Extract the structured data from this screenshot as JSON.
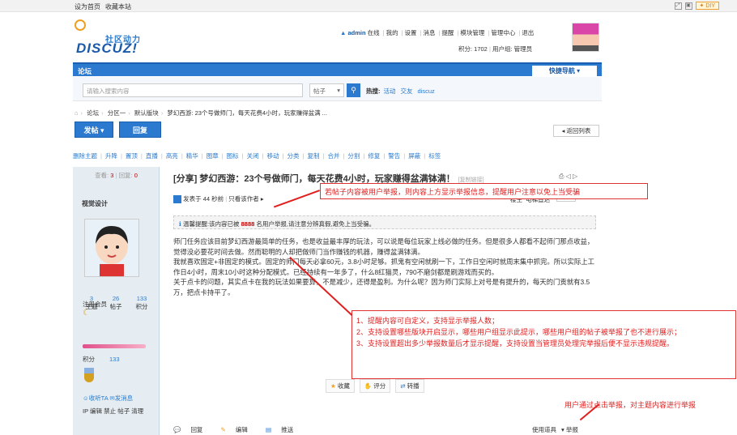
{
  "topbar": {
    "set_home": "设为首页",
    "bookmark": "收藏本站",
    "diy": "DIY"
  },
  "logo": {
    "slogan": "社区动力",
    "brand": "DISCUZ!"
  },
  "user_nav": {
    "username": "admin",
    "online": "在线",
    "items": [
      "我的",
      "设置",
      "消息",
      "提醒",
      "模块管理",
      "管理中心",
      "退出"
    ],
    "credits_label": "积分: 1702",
    "group_label": "用户组: 管理员"
  },
  "nav": {
    "current": "论坛",
    "quick_nav": "快捷导航"
  },
  "search": {
    "placeholder": "请输入搜索内容",
    "type": "帖子",
    "hot_label": "热搜:",
    "hot_items": [
      "活动",
      "交友",
      "discuz"
    ]
  },
  "breadcrumb": [
    "论坛",
    "分区一",
    "默认版块",
    "梦幻西游: 23个号做师门，每天花费4小时，玩家赚得盆满 ..."
  ],
  "buttons": {
    "post": "发帖",
    "reply": "回复",
    "back": "返回列表"
  },
  "mod_bar": [
    "删除主题",
    "升降",
    "置顶",
    "直播",
    "高亮",
    "精华",
    "图章",
    "图标",
    "关闭",
    "移动",
    "分类",
    "复制",
    "合并",
    "分割",
    "修复",
    "警告",
    "屏蔽",
    "标签"
  ],
  "left": {
    "stat_view_label": "查看:",
    "stat_view": "3",
    "stat_reply_label": "回复:",
    "stat_reply": "0",
    "author": "视觉设计",
    "numbers": [
      {
        "n": "3",
        "l": "主题"
      },
      {
        "n": "26",
        "l": "帖子"
      },
      {
        "n": "133",
        "l": "积分"
      }
    ],
    "group": "注册会员",
    "points_label": "积分",
    "points": "133",
    "links1": [
      "收听TA",
      "发消息"
    ],
    "links2": "IP 编辑 禁止 帖子 清理"
  },
  "post": {
    "title": "[分享] 梦幻西游：23个号做师门，每天花费4小时，玩家赚得盆满钵满！",
    "copy_link": "[复制链接]",
    "author_line": "发表于 44 秒前",
    "only_author": "只看该作者",
    "floor": "楼主",
    "jump": "电梯直达",
    "warning_prefix": "温馨提醒:该内容已被",
    "warning_count": "8888",
    "warning_suffix": "名用户举报,请注意分辨真假,避免上当受骗。",
    "body": [
      "师门任务应该目前梦幻西游最简单的任务，也是收益最丰厚的玩法，可以说是每位玩家上线必做的任务。但是很多人都看不起师门那点收益，觉得没必要花时间去做。然而聪明的人却把做师门当作赚钱的机器，赚得盆满钵满。",
      "我就喜欢固定+非固定的模式。固定的师门每天必拿60元，3.8小时足够。抓鬼有空闲就刷一下，工作日空闲时就周末集中抓完。所以实际上工作日4小时，周末10小时这种分配模式。已经持续有一年多了，什么8红猫灵，790不磨剑都是刷游戏而买的。",
      "关于点卡的问题，其实点卡在我的玩法如果要算，不是减少，还得是盈利。为什么呢？因为师门实际上对号是有提升的，每天的门贡就有3.5万，把点卡持平了。"
    ],
    "actions": [
      "收藏",
      "评分",
      "转播"
    ],
    "bottom_left": [
      "回复",
      "编辑",
      "推送"
    ],
    "bottom_right": [
      "使用道具",
      "举报"
    ]
  },
  "annotations": {
    "a1": "若帖子内容被用户举报，则内容上方显示举报信息，提醒用户注意以免上当受骗",
    "a2": [
      "1、提醒内容可自定义，支持显示举报人数；",
      "2、支持设置哪些版块开启显示，哪些用户组显示此提示，哪些用户组的帖子被举报了也不进行展示；",
      "3、支持设置超出多少举报数量后才显示提醒，支持设置当管理员处理完举报后便不显示违规提醒。"
    ],
    "a3": "用户通过点击举报，对主题内容进行举报"
  },
  "colors": {
    "nav": "#2c7ad0",
    "link": "#2b7acb",
    "annotation": "#e02020"
  }
}
